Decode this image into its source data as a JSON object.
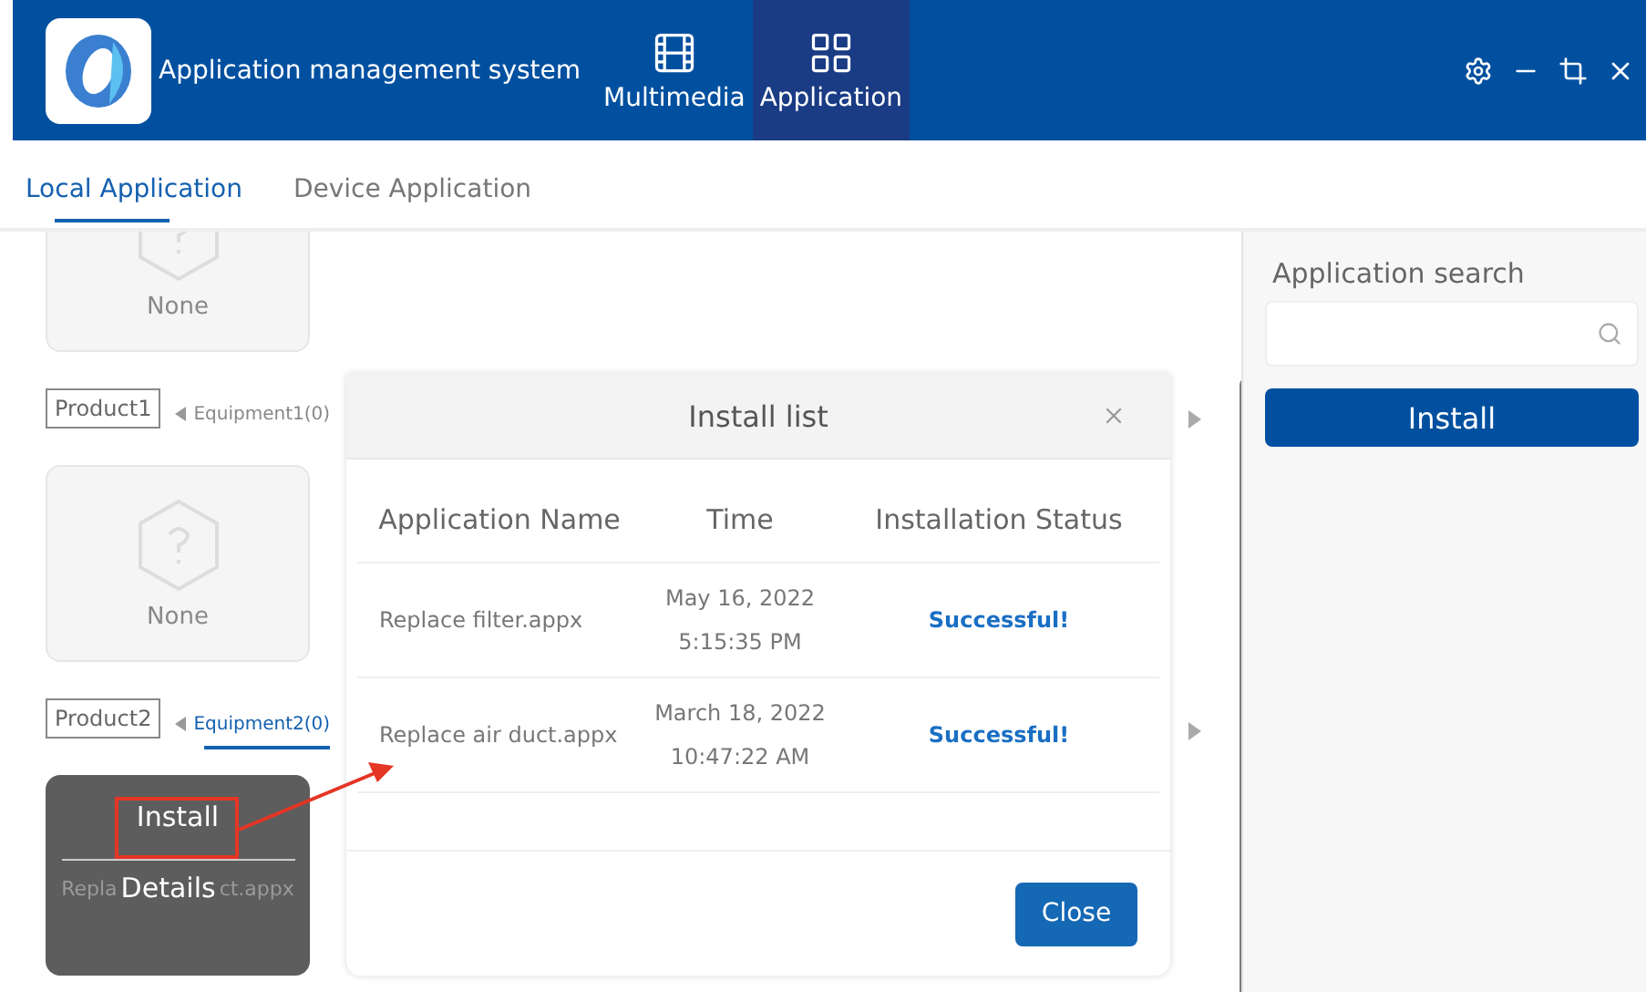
{
  "app": {
    "title": "Application management system"
  },
  "nav": [
    {
      "label": "Multimedia",
      "selected": false,
      "kind": "film"
    },
    {
      "label": "Application",
      "selected": true,
      "kind": "grid"
    }
  ],
  "tabs": [
    {
      "label": "Local Application",
      "selected": true
    },
    {
      "label": "Device Application",
      "selected": false
    }
  ],
  "top_card": {
    "label": "None"
  },
  "products": [
    {
      "name": "Product1",
      "equipment": [
        {
          "label": "Equipment1(0)",
          "selected": false
        }
      ],
      "cards": [
        {
          "kind": "empty",
          "label": "None"
        }
      ]
    },
    {
      "name": "Product2",
      "equipment": [
        {
          "label": "Equipment2(0)",
          "selected": true
        }
      ],
      "cards": [
        {
          "kind": "hover",
          "actions": [
            "Install",
            "Details"
          ],
          "name_parts": [
            "Repla",
            "ct.appx"
          ]
        }
      ]
    }
  ],
  "search": {
    "label": "Application search"
  },
  "install_button": "Install",
  "modal": {
    "title": "Install list",
    "columns": [
      "Application Name",
      "Time",
      "Installation Status"
    ],
    "rows": [
      {
        "name": "Replace filter.appx",
        "date": "May 16, 2022",
        "time": "5:15:35 PM",
        "status": "Successful!"
      },
      {
        "name": "Replace air duct.appx",
        "date": "March 18, 2022",
        "time": "10:47:22 AM",
        "status": "Successful!"
      }
    ],
    "button": "Close"
  },
  "annotation": {
    "kind": "arrow"
  }
}
